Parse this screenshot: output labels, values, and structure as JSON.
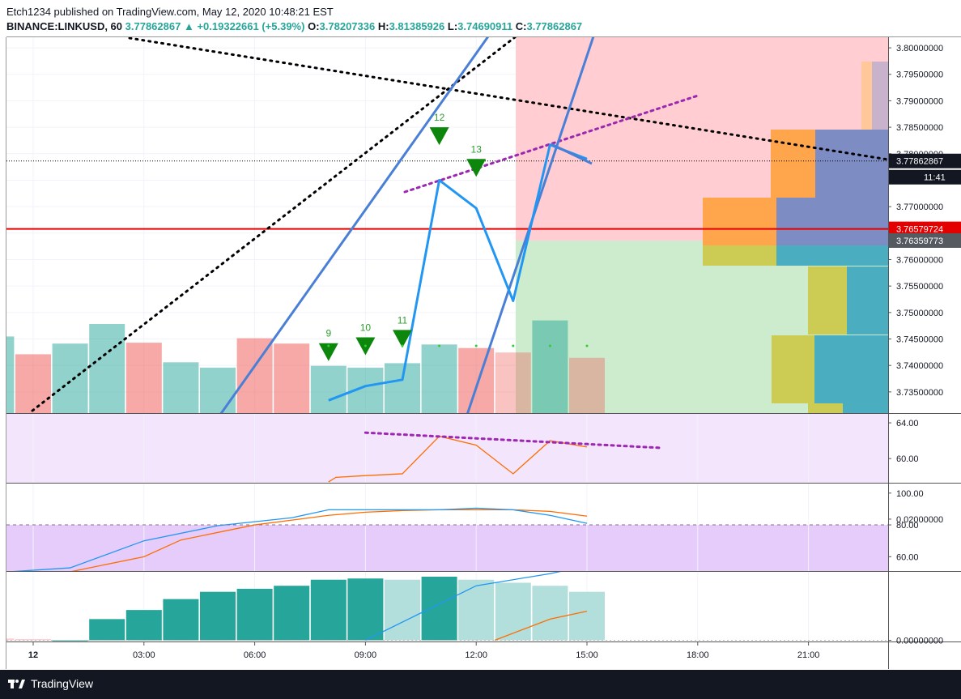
{
  "header": {
    "line1": "Etch1234 published on TradingView.com, May 12, 2020 10:48:21 EST",
    "symbol": "BINANCE:LINKUSD, 60",
    "last": "3.77862867",
    "arrow": "▲",
    "change": "+0.19322661 (+5.39%)",
    "o_label": "O:",
    "o_val": "3.78207336",
    "h_label": "H:",
    "h_val": "3.81385926",
    "l_label": "L:",
    "l_val": "3.74690911",
    "c_label": "C:",
    "c_val": "3.77862867"
  },
  "footer": {
    "brand": "TradingView"
  },
  "colors": {
    "up": "#26a69a",
    "down": "#ef5350",
    "blue": "#2196f3",
    "orange": "#ff6d00",
    "purple": "#9c27b0",
    "red_line": "#e50000",
    "price_bg": "#000000"
  },
  "chart_data": {
    "type": "bar",
    "price_axis": {
      "ylim": [
        3.731,
        3.802
      ],
      "ticks": [
        "3.80000000",
        "3.79500000",
        "3.79000000",
        "3.78500000",
        "3.78000000",
        "3.77500000",
        "3.77000000",
        "3.76500000",
        "3.76000000",
        "3.75500000",
        "3.75000000",
        "3.74500000",
        "3.74000000",
        "3.73500000"
      ]
    },
    "price_labels": [
      {
        "value": 3.77862867,
        "text": "3.77862867",
        "style": "dark"
      },
      {
        "value": 3.7744,
        "text": "11:41",
        "style": "dark"
      },
      {
        "value": 3.76579724,
        "text": "3.76579724",
        "style": "red"
      },
      {
        "value": 3.76359773,
        "text": "3.76359773",
        "style": "gray"
      }
    ],
    "time_axis": {
      "labels": [
        "12",
        "03:00",
        "06:00",
        "09:00",
        "12:00",
        "15:00",
        "18:00",
        "21:00"
      ],
      "label_hours": [
        0,
        3,
        6,
        9,
        12,
        15,
        18,
        21
      ]
    },
    "volume": [
      {
        "h": -1,
        "v": 0.86,
        "dir": "up"
      },
      {
        "h": 0,
        "v": 0.66,
        "dir": "down"
      },
      {
        "h": 1,
        "v": 0.78,
        "dir": "up"
      },
      {
        "h": 2,
        "v": 1.0,
        "dir": "up"
      },
      {
        "h": 3,
        "v": 0.79,
        "dir": "down"
      },
      {
        "h": 4,
        "v": 0.57,
        "dir": "up"
      },
      {
        "h": 5,
        "v": 0.51,
        "dir": "up"
      },
      {
        "h": 6,
        "v": 0.84,
        "dir": "down"
      },
      {
        "h": 7,
        "v": 0.78,
        "dir": "down"
      },
      {
        "h": 8,
        "v": 0.53,
        "dir": "up"
      },
      {
        "h": 9,
        "v": 0.51,
        "dir": "up"
      },
      {
        "h": 10,
        "v": 0.56,
        "dir": "up"
      },
      {
        "h": 11,
        "v": 0.77,
        "dir": "up"
      },
      {
        "h": 12,
        "v": 0.73,
        "dir": "down"
      },
      {
        "h": 13,
        "v": 0.68,
        "dir": "down"
      },
      {
        "h": 14,
        "v": 1.04,
        "dir": "up"
      },
      {
        "h": 15,
        "v": 0.62,
        "dir": "down"
      }
    ],
    "price_line": [
      [
        8,
        3.7334
      ],
      [
        9,
        3.7361
      ],
      [
        10,
        3.7373
      ],
      [
        11,
        3.775
      ],
      [
        12,
        3.7697
      ],
      [
        13,
        3.7522
      ],
      [
        14,
        3.7817
      ],
      [
        15,
        3.779
      ]
    ],
    "td_markers": [
      {
        "h": 8,
        "label": "9",
        "price": 3.7442
      },
      {
        "h": 9,
        "label": "10",
        "price": 3.7453
      },
      {
        "h": 10,
        "label": "11",
        "price": 3.7467
      },
      {
        "h": 11,
        "label": "12",
        "price": 3.785
      },
      {
        "h": 12,
        "label": "13",
        "price": 3.779
      }
    ],
    "rsi": {
      "ticks": [
        "64.00",
        "60.00"
      ],
      "ylim": [
        57.3,
        65.0
      ],
      "line": [
        [
          8,
          57.4
        ],
        [
          8.2,
          57.9
        ],
        [
          9,
          58.1
        ],
        [
          10,
          58.3
        ],
        [
          11,
          62.5
        ],
        [
          12,
          61.5
        ],
        [
          13,
          58.3
        ],
        [
          14,
          62.0
        ],
        [
          15,
          61.3
        ]
      ],
      "trend": [
        [
          9,
          62.9
        ],
        [
          17,
          61.2
        ]
      ]
    },
    "stoch": {
      "ticks": [
        "100.00",
        "80.00",
        "60.00"
      ],
      "ylim": [
        51,
        106
      ],
      "band": [
        50,
        80
      ],
      "k": [
        [
          -1,
          50.0
        ],
        [
          1,
          53.0
        ],
        [
          3,
          70.0
        ],
        [
          5,
          79.5
        ],
        [
          7,
          84.5
        ],
        [
          8,
          89.5
        ],
        [
          9,
          89.5
        ],
        [
          10,
          89.5
        ],
        [
          11,
          89.5
        ],
        [
          12,
          90.5
        ],
        [
          13,
          89.5
        ],
        [
          14,
          86.0
        ],
        [
          15,
          81.0
        ]
      ],
      "d": [
        [
          -1,
          49.0
        ],
        [
          1,
          50.5
        ],
        [
          3,
          60.0
        ],
        [
          4,
          70.5
        ],
        [
          6,
          80.0
        ],
        [
          8,
          86.0
        ],
        [
          9,
          88.0
        ],
        [
          10,
          89.0
        ],
        [
          11,
          89.5
        ],
        [
          12,
          89.5
        ],
        [
          13,
          89.5
        ],
        [
          14,
          88.5
        ],
        [
          15,
          85.5
        ]
      ]
    },
    "macd": {
      "ticks": [
        "0.02000000",
        "0.00000000"
      ],
      "ylim": [
        -0.0002,
        0.0113
      ],
      "hist": [
        [
          -1,
          0.0003
        ],
        [
          0,
          0.0002
        ],
        [
          1,
          0.0
        ],
        [
          2,
          0.0035
        ],
        [
          3,
          0.005
        ],
        [
          4,
          0.0068
        ],
        [
          5,
          0.008
        ],
        [
          6,
          0.0085
        ],
        [
          7,
          0.009
        ],
        [
          8,
          0.01
        ],
        [
          9,
          0.0102
        ],
        [
          10,
          0.01
        ],
        [
          11,
          0.0105
        ],
        [
          12,
          0.01
        ],
        [
          13,
          0.0095
        ],
        [
          14,
          0.009
        ],
        [
          15,
          0.008
        ]
      ],
      "fading_from": 10,
      "macd_line": [
        [
          9,
          0.0
        ],
        [
          11,
          0.006
        ],
        [
          12,
          0.009
        ],
        [
          14,
          0.011
        ],
        [
          15,
          0.0123
        ]
      ],
      "signal": [
        [
          12.5,
          0.0
        ],
        [
          14,
          0.0035
        ],
        [
          15,
          0.0048
        ]
      ]
    }
  }
}
